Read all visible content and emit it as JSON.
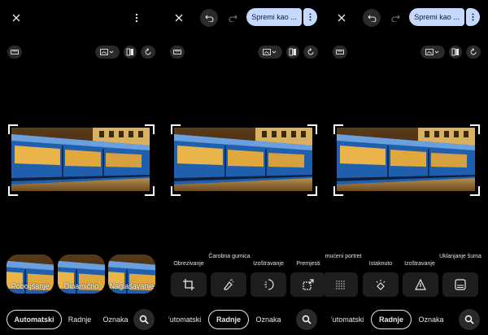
{
  "save_button": "Spremi kao ...",
  "tabs": {
    "automatic": "Automatski",
    "automatic_cut": "’utomatski",
    "actions": "Radnje",
    "markup": "Oznaka"
  },
  "suggestions": [
    "Poboljšanje",
    "Dinamično",
    "Naglašavanje"
  ],
  "tools_actions": [
    "Obrezivanje",
    "Čarobna gumica",
    "Izoštravanje",
    "Premjesti"
  ],
  "tools_people": [
    "Zamućeni portret",
    "Istaknuto",
    "Izoštravanje",
    "Uklanjanje šuma"
  ],
  "colors": {
    "accent": "#c7d8ff",
    "background": "#000000",
    "chip": "#2a2a2a"
  }
}
